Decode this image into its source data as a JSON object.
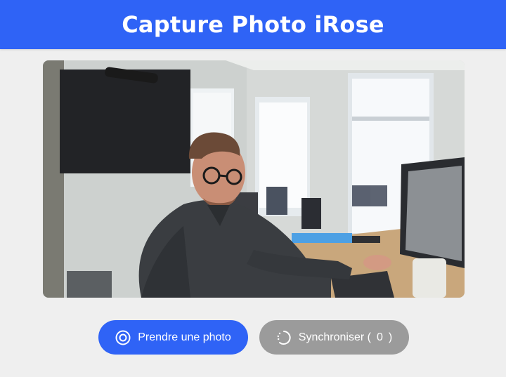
{
  "header": {
    "title": "Capture Photo iRose"
  },
  "preview": {
    "description_icon": "camera-preview"
  },
  "actions": {
    "capture_label": "Prendre une photo",
    "capture_icon": "camera-shutter-icon",
    "sync_label": "Synchroniser (",
    "sync_count": "0",
    "sync_suffix": ")",
    "sync_icon": "sync-spinner-icon"
  },
  "colors": {
    "primary": "#2f63f6",
    "secondary": "#9b9b9b",
    "background": "#efefef"
  }
}
